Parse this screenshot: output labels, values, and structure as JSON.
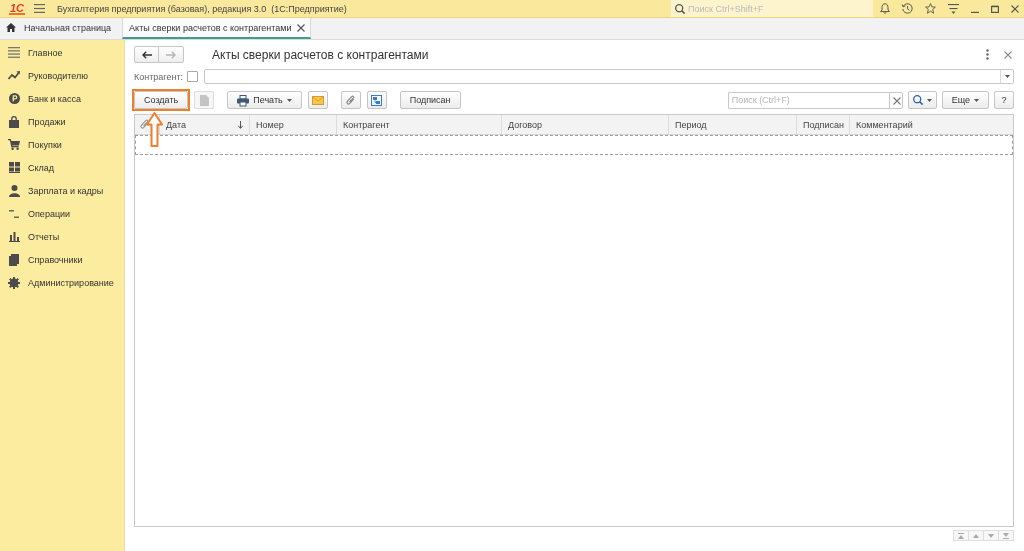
{
  "app_bar": {
    "logo": "1С",
    "title": "Бухгалтерия предприятия (базовая), редакция 3.0  (1С:Предприятие)",
    "search": {
      "placeholder": "Поиск Ctrl+Shift+F"
    }
  },
  "tabs": [
    {
      "kind": "home",
      "label": "Начальная страница",
      "selected": false
    },
    {
      "kind": "document",
      "label": "Акты сверки расчетов с контрагентами",
      "selected": true
    }
  ],
  "sidebar": {
    "items": [
      {
        "kind": "main",
        "label": "Главное",
        "selected": false
      },
      {
        "kind": "manager",
        "label": "Руководителю",
        "selected": false
      },
      {
        "kind": "bank",
        "label": "Банк и касса",
        "selected": false
      },
      {
        "kind": "sales",
        "label": "Продажи",
        "selected": false
      },
      {
        "kind": "purchases",
        "label": "Покупки",
        "selected": false
      },
      {
        "kind": "warehouse",
        "label": "Склад",
        "selected": false
      },
      {
        "kind": "salary",
        "label": "Зарплата и кадры",
        "selected": false
      },
      {
        "kind": "operations",
        "label": "Операции",
        "selected": false
      },
      {
        "kind": "reports",
        "label": "Отчеты",
        "selected": false
      },
      {
        "kind": "catalogs",
        "label": "Справочники",
        "selected": false
      },
      {
        "kind": "admin",
        "label": "Администрирование",
        "selected": false
      }
    ]
  },
  "form": {
    "title": "Акты сверки расчетов с контрагентами",
    "navigation": [
      {
        "kind": "back",
        "disabled": false
      },
      {
        "kind": "forward",
        "disabled": true
      }
    ],
    "filter": {
      "label": "Контрагент:",
      "checked": false
    },
    "toolbar": {
      "groups": [
        {
          "items": [
            {
              "kind": "button",
              "label": "Создать",
              "disabled": false,
              "highlighted": true
            },
            {
              "kind": "icon",
              "disabled": true,
              "highlighted": false
            }
          ]
        },
        {
          "items": [
            {
              "kind": "menu",
              "label": "Печать",
              "disabled": false,
              "highlighted": false
            },
            {
              "kind": "icon",
              "disabled": false,
              "highlighted": false
            }
          ]
        },
        {
          "items": [
            {
              "kind": "icon",
              "disabled": false,
              "highlighted": false
            },
            {
              "kind": "icon",
              "disabled": false,
              "highlighted": false
            }
          ]
        },
        {
          "items": [
            {
              "kind": "button",
              "label": "Подписан",
              "disabled": false,
              "highlighted": false
            }
          ]
        }
      ]
    },
    "search": {
      "placeholder": "Поиск (Ctrl+F)"
    },
    "more_button": {
      "label": "Еще"
    },
    "help_button": {
      "label": "?"
    },
    "table": {
      "columns": [
        {
          "kind": "attachment"
        },
        {
          "kind": "text",
          "label": "Дата",
          "sorted": true
        },
        {
          "kind": "text",
          "label": "Номер",
          "sorted": false
        },
        {
          "kind": "text",
          "label": "Контрагент",
          "sorted": false
        },
        {
          "kind": "text",
          "label": "Договор",
          "sorted": false
        },
        {
          "kind": "text",
          "label": "Период",
          "sorted": false
        },
        {
          "kind": "text",
          "label": "Подписан",
          "sorted": false
        },
        {
          "kind": "text",
          "label": "Комментарий",
          "sorted": false
        }
      ]
    }
  }
}
